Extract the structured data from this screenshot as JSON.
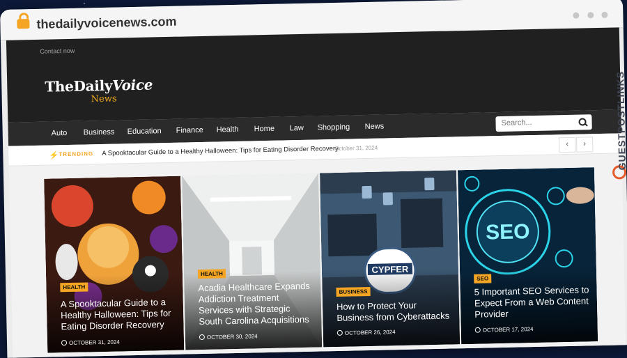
{
  "browser": {
    "url": "thedailyvoicenews.com"
  },
  "site": {
    "contact_link": "Contact now",
    "logo": {
      "line1a": "The",
      "line1b": "Daily",
      "line1c": "Voice",
      "line2": "News"
    },
    "nav": {
      "items": [
        {
          "label": "Auto"
        },
        {
          "label": "Business"
        },
        {
          "label": "Education"
        },
        {
          "label": "Finance"
        },
        {
          "label": "Health"
        },
        {
          "label": "Home"
        },
        {
          "label": "Law"
        },
        {
          "label": "Shopping"
        },
        {
          "label": "News"
        }
      ],
      "search_placeholder": "Search..."
    },
    "trending": {
      "label": "TRENDING",
      "title": "A Spooktacular Guide to a Healthy Halloween: Tips for Eating Disorder Recovery",
      "date": "October 31, 2024",
      "prev_icon": "chevron-left",
      "next_icon": "chevron-right"
    },
    "cards": [
      {
        "category": "HEALTH",
        "title": "A Spooktacular Guide to a Healthy Halloween: Tips for Eating Disorder Recovery",
        "date": "OCTOBER 31, 2024",
        "image": "halloween-cupcakes"
      },
      {
        "category": "HEALTH",
        "title": "Acadia Healthcare Expands Addiction Treatment Services with Strategic South Carolina Acquisitions",
        "date": "OCTOBER 30, 2024",
        "image": "hospital-corridor"
      },
      {
        "category": "BUSINESS",
        "title": "How to Protect Your Business from Cyberattacks",
        "date": "OCTOBER 26, 2024",
        "image": "cypfer-security-laptop",
        "image_text": "CYPFER"
      },
      {
        "category": "SEO",
        "title": "5 Important SEO Services to Expect From a Web Content Provider",
        "date": "OCTOBER 17, 2024",
        "image": "seo-hologram",
        "image_text": "SEO"
      }
    ]
  },
  "watermark": {
    "text": "GUESTPOSTLINKS"
  },
  "colors": {
    "accent": "#f4a523",
    "header_bg": "#202020",
    "nav_bg": "#2b2b2b",
    "page_bg": "#0d1a3a"
  }
}
